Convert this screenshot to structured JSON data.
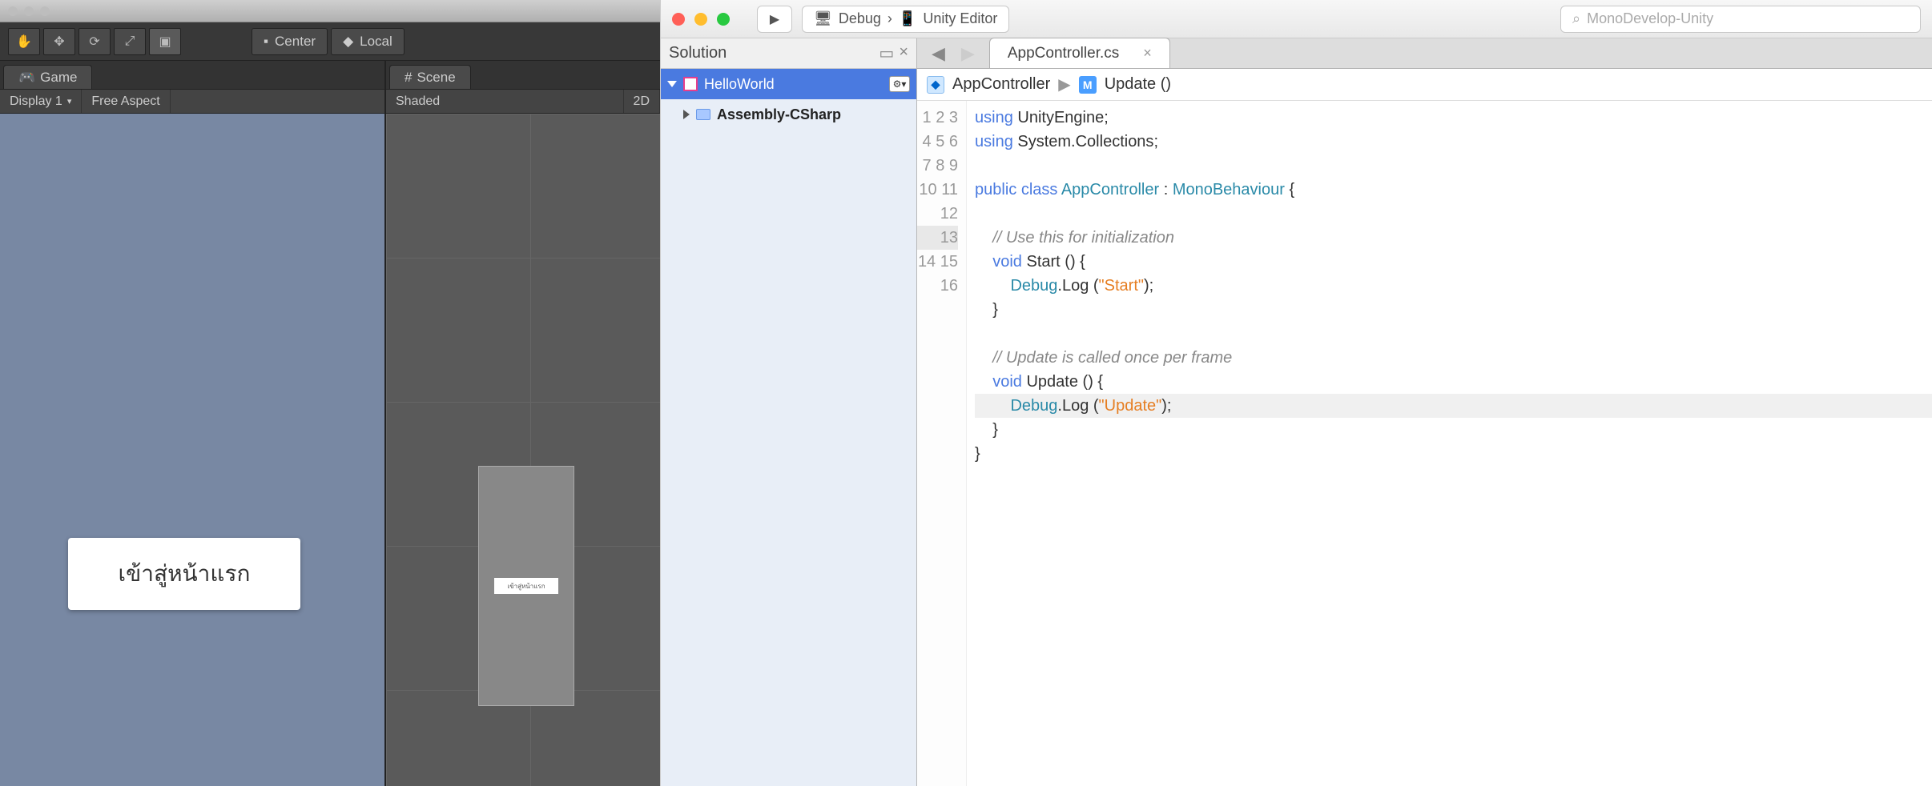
{
  "unity": {
    "toolbar": {
      "center": "Center",
      "local": "Local"
    },
    "gameTab": "Game",
    "sceneTab": "Scene",
    "display": "Display 1",
    "aspect": "Free Aspect",
    "shaded": "Shaded",
    "twoD": "2D",
    "gameButton": "เข้าสู่หน้าแรก",
    "sceneButtonSmall": "เข้าสู่หน้าแรก"
  },
  "mono": {
    "config": "Debug",
    "target": "Unity Editor",
    "search": "MonoDevelop-Unity",
    "solutionTitle": "Solution",
    "project": "HelloWorld",
    "assembly": "Assembly-CSharp",
    "tab": "AppController.cs",
    "bcClass": "AppController",
    "bcMethod": "Update ()",
    "lines": [
      "1",
      "2",
      "3",
      "4",
      "5",
      "6",
      "7",
      "8",
      "9",
      "10",
      "11",
      "12",
      "13",
      "14",
      "15",
      "16"
    ],
    "code": {
      "l1a": "using ",
      "l1b": "UnityEngine",
      "l2a": "using ",
      "l2b": "System.Collections",
      "l4a": "public ",
      "l4b": "class ",
      "l4c": "AppController ",
      "l4d": ": ",
      "l4e": "MonoBehaviour ",
      "l4f": "{",
      "l6": "    // Use this for initialization",
      "l7a": "    void ",
      "l7b": "Start () {",
      "l8a": "        Debug",
      ".l8b": ".",
      "l8c": "Log (",
      "l8d": "\"Start\"",
      "l8e": ");",
      "l9": "    }",
      "l11": "    // Update is called once per frame",
      "l12a": "    void ",
      "l12b": "Update () {",
      "l13a": "        Debug",
      "l13b": ".",
      "l13c": "Log (",
      "l13d": "\"Update\"",
      "l13e": ");",
      "l14": "    }",
      "l15": "}"
    }
  }
}
